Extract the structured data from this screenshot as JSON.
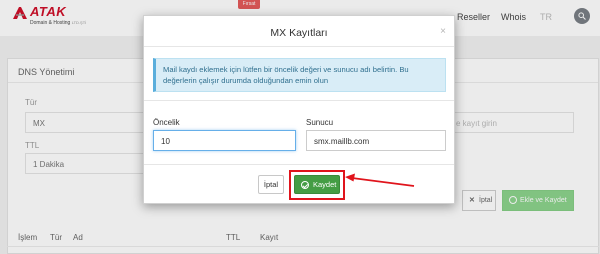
{
  "header": {
    "logo_name": "ATAK",
    "logo_sub": "Domain & Hosting",
    "logo_sub_small": "LTD.ŞTİ",
    "badge": "Fırsat",
    "nav": [
      "Reseller",
      "Whois",
      "TR"
    ]
  },
  "dns_panel": {
    "title": "DNS Yönetimi",
    "type_label": "Tür",
    "type_value": "MX",
    "ttl_label": "TTL",
    "ttl_value": "1 Dakika",
    "record_placeholder": "e kayıt girin",
    "cancel_label": "İptal",
    "add_save_label": "Ekle ve Kaydet",
    "columns": [
      "İşlem",
      "Tür",
      "Ad",
      "TTL",
      "Kayıt"
    ]
  },
  "modal": {
    "title": "MX Kayıtları",
    "close": "×",
    "alert_text": "Mail kaydı eklemek için lütfen bir öncelik değeri ve sunucu adı belirtin. Bu değerlerin çalışır durumda olduğundan emin olun",
    "priority_label": "Öncelik",
    "priority_value": "10",
    "server_label": "Sunucu",
    "server_value": "smx.maillb.com",
    "cancel_label": "İptal",
    "save_label": "Kaydet"
  },
  "colors": {
    "brand_red": "#d0102a",
    "save_green": "#449d44",
    "alert_bg": "#d9edf7",
    "highlight_red": "#e0141c"
  },
  "icons": [
    "atak-logo-icon",
    "search-icon",
    "check-circle-icon",
    "close-icon",
    "annotation-arrow-icon"
  ]
}
